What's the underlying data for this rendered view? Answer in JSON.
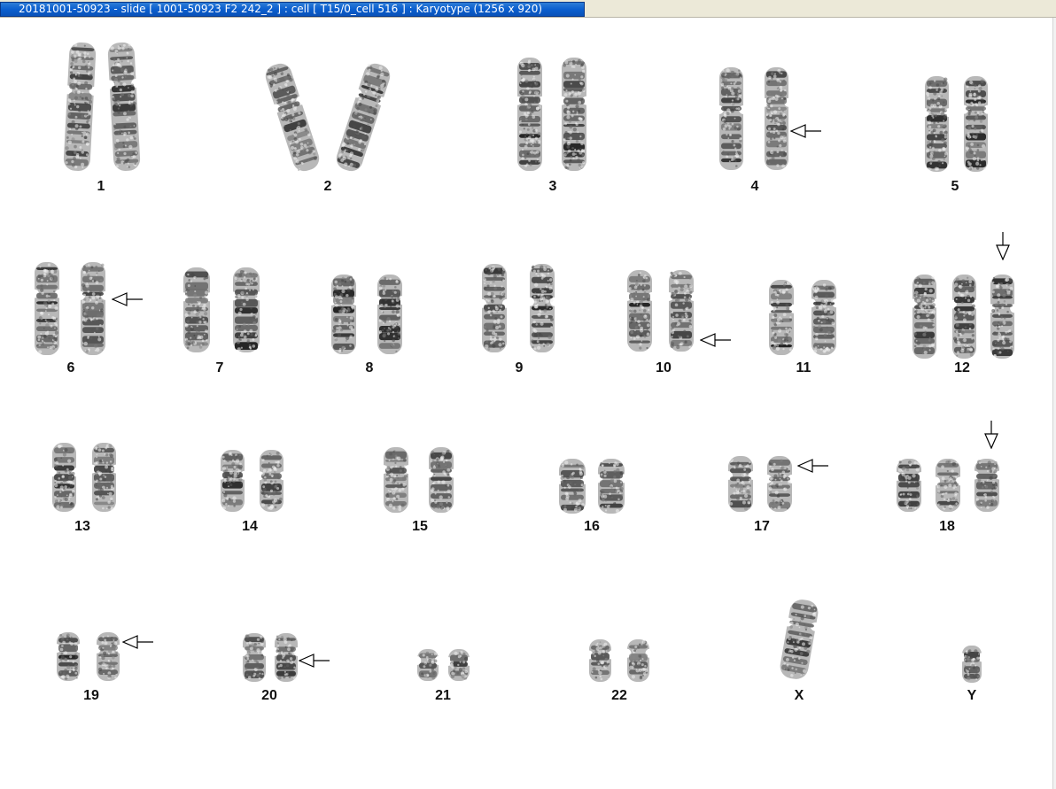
{
  "window": {
    "title": "20181001-50923 - slide [ 1001-50923 F2 242_2 ] : cell [ T15/0_cell 516 ] : Karyotype  (1256 x 920)"
  },
  "karyotype": {
    "groups": [
      {
        "label": "1",
        "count": 2,
        "abnormal": false
      },
      {
        "label": "2",
        "count": 2,
        "abnormal": false
      },
      {
        "label": "3",
        "count": 2,
        "abnormal": false
      },
      {
        "label": "4",
        "count": 2,
        "abnormal": true,
        "marker": "side"
      },
      {
        "label": "5",
        "count": 2,
        "abnormal": false
      },
      {
        "label": "6",
        "count": 2,
        "abnormal": true,
        "marker": "side"
      },
      {
        "label": "7",
        "count": 2,
        "abnormal": false
      },
      {
        "label": "8",
        "count": 2,
        "abnormal": false
      },
      {
        "label": "9",
        "count": 2,
        "abnormal": false
      },
      {
        "label": "10",
        "count": 2,
        "abnormal": true,
        "marker": "side"
      },
      {
        "label": "11",
        "count": 2,
        "abnormal": false
      },
      {
        "label": "12",
        "count": 3,
        "abnormal": true,
        "marker": "above"
      },
      {
        "label": "13",
        "count": 2,
        "abnormal": false
      },
      {
        "label": "14",
        "count": 2,
        "abnormal": false
      },
      {
        "label": "15",
        "count": 2,
        "abnormal": false
      },
      {
        "label": "16",
        "count": 2,
        "abnormal": false
      },
      {
        "label": "17",
        "count": 2,
        "abnormal": true,
        "marker": "side"
      },
      {
        "label": "18",
        "count": 3,
        "abnormal": true,
        "marker": "above"
      },
      {
        "label": "19",
        "count": 2,
        "abnormal": true,
        "marker": "side"
      },
      {
        "label": "20",
        "count": 2,
        "abnormal": true,
        "marker": "side"
      },
      {
        "label": "21",
        "count": 2,
        "abnormal": false
      },
      {
        "label": "22",
        "count": 2,
        "abnormal": false
      },
      {
        "label": "X",
        "count": 1,
        "abnormal": false
      },
      {
        "label": "Y",
        "count": 1,
        "abnormal": false
      }
    ]
  }
}
